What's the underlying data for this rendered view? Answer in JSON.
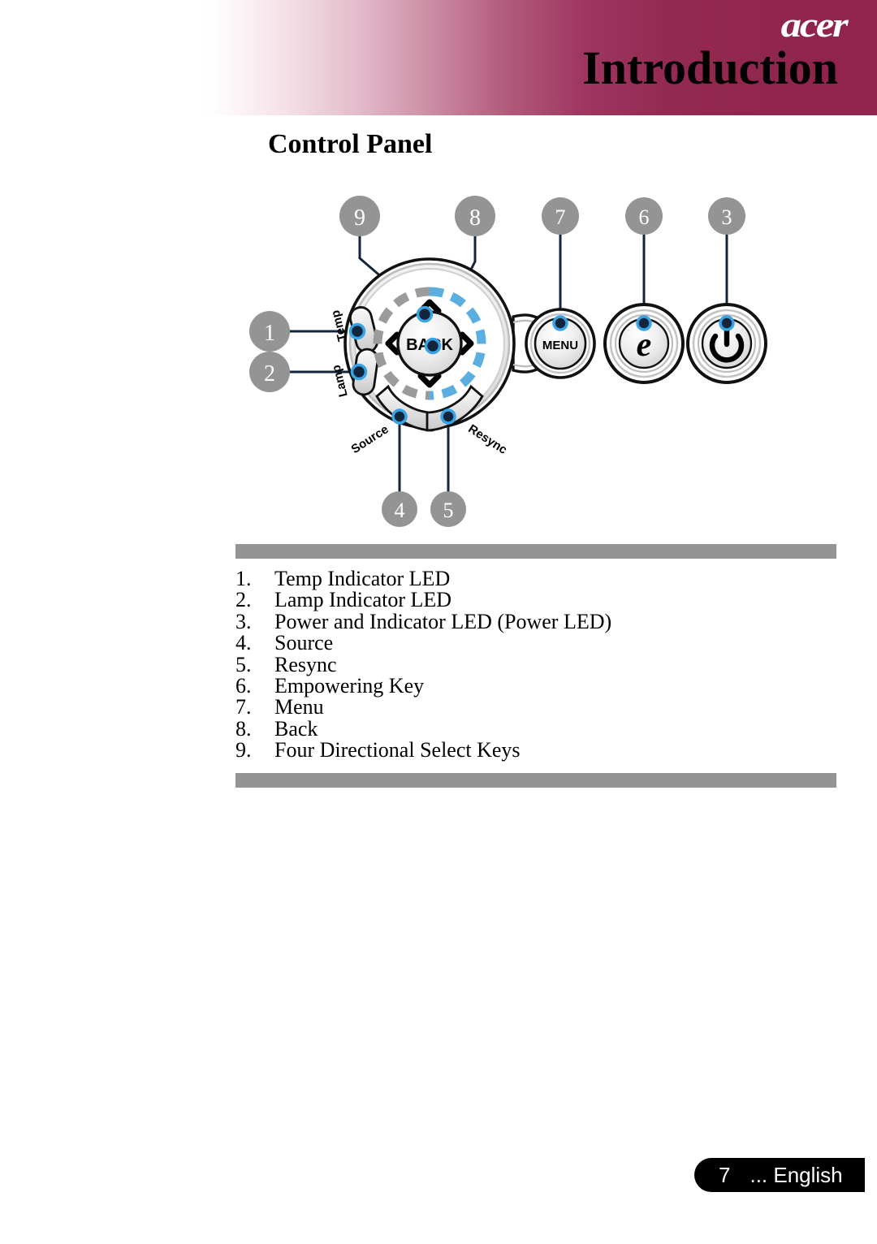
{
  "header": {
    "title": "Introduction",
    "brand_logo": "acer",
    "bg_color": "#90244c"
  },
  "section": {
    "heading": "Control Panel"
  },
  "diagram": {
    "name": "control-panel-diagram",
    "callout_badges": [
      {
        "number": "1",
        "target": "Temp Indicator LED"
      },
      {
        "number": "2",
        "target": "Lamp Indicator LED"
      },
      {
        "number": "3",
        "target": "Power Button"
      },
      {
        "number": "4",
        "target": "Source"
      },
      {
        "number": "5",
        "target": "Resync"
      },
      {
        "number": "6",
        "target": "Empowering Key"
      },
      {
        "number": "7",
        "target": "Menu"
      },
      {
        "number": "8",
        "target": "Back"
      },
      {
        "number": "9",
        "target": "Four Directional Select Keys"
      }
    ],
    "labels": {
      "temp": "Temp",
      "lamp": "Lamp",
      "source": "Source",
      "resync": "Resync",
      "back": "BACK",
      "menu": "MENU",
      "empowering": "e"
    },
    "badge_color": "#949494",
    "accent_color": "#2e9fe0",
    "leader_color": "#11263d"
  },
  "list": {
    "items": [
      {
        "num": "1.",
        "label": "Temp Indicator LED"
      },
      {
        "num": "2.",
        "label": "Lamp Indicator LED"
      },
      {
        "num": "3.",
        "label": "Power and Indicator LED (Power LED)"
      },
      {
        "num": "4.",
        "label": "Source"
      },
      {
        "num": "5.",
        "label": "Resync"
      },
      {
        "num": "6.",
        "label": "Empowering Key"
      },
      {
        "num": "7.",
        "label": "Menu"
      },
      {
        "num": "8.",
        "label": "Back"
      },
      {
        "num": "9.",
        "label": "Four Directional Select Keys"
      }
    ],
    "bar_color": "#949494"
  },
  "footer": {
    "page_number": "7",
    "language": "... English"
  }
}
